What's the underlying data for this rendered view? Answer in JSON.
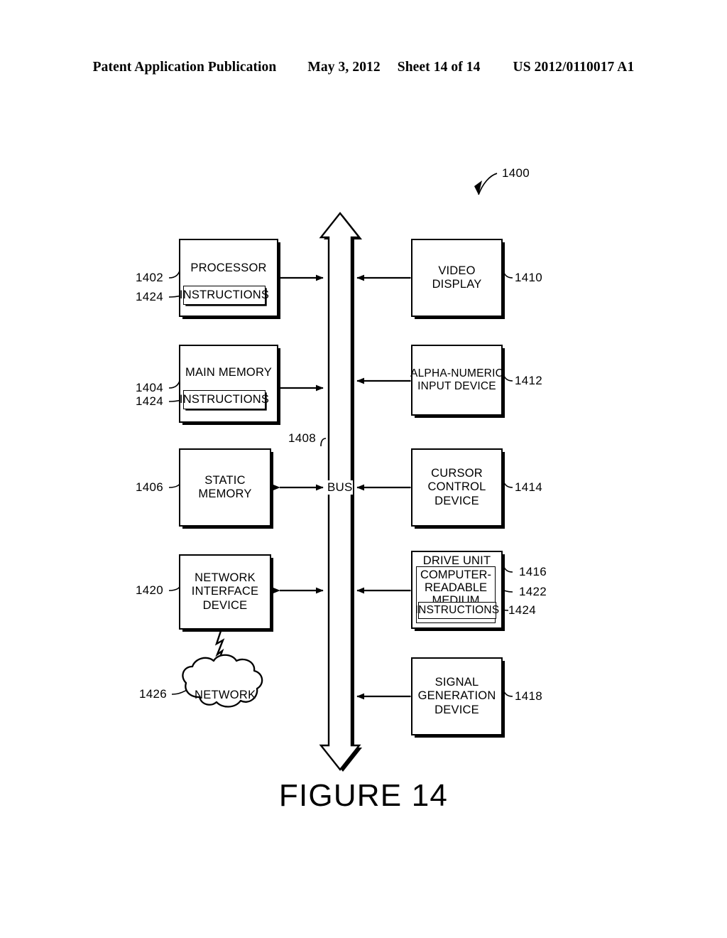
{
  "header": {
    "publication": "Patent Application Publication",
    "date": "May 3, 2012",
    "sheet": "Sheet 14 of 14",
    "patent_number": "US 2012/0110017 A1"
  },
  "figure": {
    "caption": "FIGURE 14",
    "system_ref": "1400",
    "bus_label": "BUS",
    "bus_ref": "1408"
  },
  "left_column": {
    "processor": {
      "title": "PROCESSOR",
      "ref": "1402",
      "instructions_label": "INSTRUCTIONS",
      "instructions_ref": "1424"
    },
    "main_memory": {
      "title": "MAIN MEMORY",
      "ref": "1404",
      "instructions_label": "INSTRUCTIONS",
      "instructions_ref": "1424"
    },
    "static_memory": {
      "title_line1": "STATIC",
      "title_line2": "MEMORY",
      "ref": "1406"
    },
    "network_interface_device": {
      "title_line1": "NETWORK",
      "title_line2": "INTERFACE",
      "title_line3": "DEVICE",
      "ref": "1420"
    },
    "network": {
      "title": "NETWORK",
      "ref": "1426"
    }
  },
  "right_column": {
    "video_display": {
      "title_line1": "VIDEO",
      "title_line2": "DISPLAY",
      "ref": "1410"
    },
    "alpha_numeric_input_device": {
      "title_line1": "ALPHA-NUMERIC",
      "title_line2": "INPUT DEVICE",
      "ref": "1412"
    },
    "cursor_control_device": {
      "title_line1": "CURSOR",
      "title_line2": "CONTROL",
      "title_line3": "DEVICE",
      "ref": "1414"
    },
    "drive_unit": {
      "title": "DRIVE UNIT",
      "ref": "1416",
      "medium_line1": "COMPUTER-",
      "medium_line2": "READABLE",
      "medium_line3": "MEDIUM",
      "medium_ref": "1422",
      "instructions_label": "INSTRUCTIONS",
      "instructions_ref": "1424"
    },
    "signal_generation_device": {
      "title_line1": "SIGNAL",
      "title_line2": "GENERATION",
      "title_line3": "DEVICE",
      "ref": "1418"
    }
  }
}
